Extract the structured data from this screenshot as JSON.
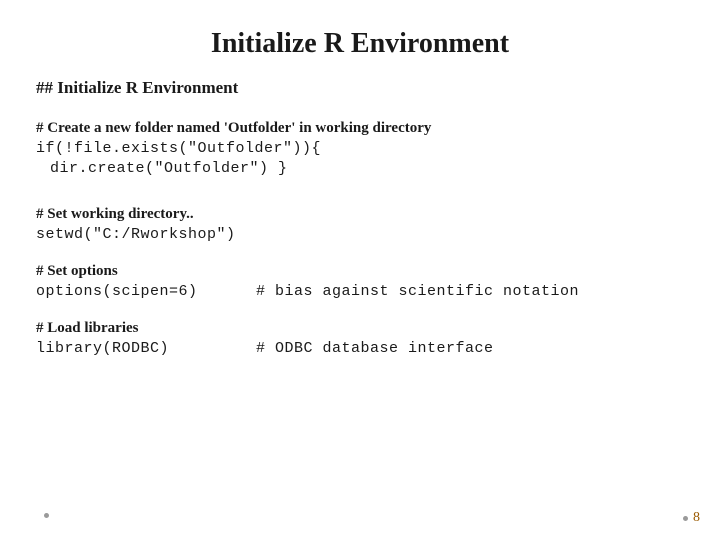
{
  "title": "Initialize R Environment",
  "section_heading": "## Initialize R Environment",
  "block1": {
    "heading": "# Create a new folder named 'Outfolder' in working directory",
    "line1": "if(!file.exists(\"Outfolder\")){",
    "line2": "dir.create(\"Outfolder\") }"
  },
  "block2": {
    "heading": "# Set working directory..",
    "line1": "setwd(\"C:/Rworkshop\")"
  },
  "block3": {
    "heading": "# Set options",
    "line1": "options(scipen=6)",
    "comment": "# bias against scientific notation"
  },
  "block4": {
    "heading": "# Load libraries",
    "line1": "library(RODBC)",
    "comment": "# ODBC database interface"
  },
  "page_number": "8"
}
